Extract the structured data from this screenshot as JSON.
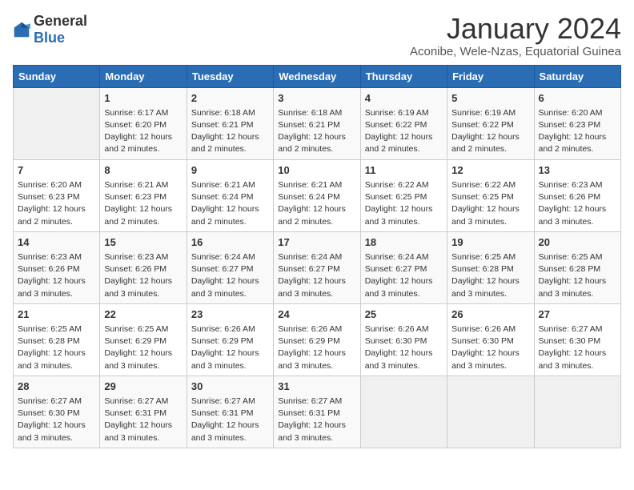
{
  "logo": {
    "general": "General",
    "blue": "Blue"
  },
  "title": "January 2024",
  "subtitle": "Aconibe, Wele-Nzas, Equatorial Guinea",
  "days_of_week": [
    "Sunday",
    "Monday",
    "Tuesday",
    "Wednesday",
    "Thursday",
    "Friday",
    "Saturday"
  ],
  "weeks": [
    [
      {
        "day": "",
        "info": ""
      },
      {
        "day": "1",
        "info": "Sunrise: 6:17 AM\nSunset: 6:20 PM\nDaylight: 12 hours\nand 2 minutes."
      },
      {
        "day": "2",
        "info": "Sunrise: 6:18 AM\nSunset: 6:21 PM\nDaylight: 12 hours\nand 2 minutes."
      },
      {
        "day": "3",
        "info": "Sunrise: 6:18 AM\nSunset: 6:21 PM\nDaylight: 12 hours\nand 2 minutes."
      },
      {
        "day": "4",
        "info": "Sunrise: 6:19 AM\nSunset: 6:22 PM\nDaylight: 12 hours\nand 2 minutes."
      },
      {
        "day": "5",
        "info": "Sunrise: 6:19 AM\nSunset: 6:22 PM\nDaylight: 12 hours\nand 2 minutes."
      },
      {
        "day": "6",
        "info": "Sunrise: 6:20 AM\nSunset: 6:23 PM\nDaylight: 12 hours\nand 2 minutes."
      }
    ],
    [
      {
        "day": "7",
        "info": "Sunrise: 6:20 AM\nSunset: 6:23 PM\nDaylight: 12 hours\nand 2 minutes."
      },
      {
        "day": "8",
        "info": "Sunrise: 6:21 AM\nSunset: 6:23 PM\nDaylight: 12 hours\nand 2 minutes."
      },
      {
        "day": "9",
        "info": "Sunrise: 6:21 AM\nSunset: 6:24 PM\nDaylight: 12 hours\nand 2 minutes."
      },
      {
        "day": "10",
        "info": "Sunrise: 6:21 AM\nSunset: 6:24 PM\nDaylight: 12 hours\nand 2 minutes."
      },
      {
        "day": "11",
        "info": "Sunrise: 6:22 AM\nSunset: 6:25 PM\nDaylight: 12 hours\nand 3 minutes."
      },
      {
        "day": "12",
        "info": "Sunrise: 6:22 AM\nSunset: 6:25 PM\nDaylight: 12 hours\nand 3 minutes."
      },
      {
        "day": "13",
        "info": "Sunrise: 6:23 AM\nSunset: 6:26 PM\nDaylight: 12 hours\nand 3 minutes."
      }
    ],
    [
      {
        "day": "14",
        "info": "Sunrise: 6:23 AM\nSunset: 6:26 PM\nDaylight: 12 hours\nand 3 minutes."
      },
      {
        "day": "15",
        "info": "Sunrise: 6:23 AM\nSunset: 6:26 PM\nDaylight: 12 hours\nand 3 minutes."
      },
      {
        "day": "16",
        "info": "Sunrise: 6:24 AM\nSunset: 6:27 PM\nDaylight: 12 hours\nand 3 minutes."
      },
      {
        "day": "17",
        "info": "Sunrise: 6:24 AM\nSunset: 6:27 PM\nDaylight: 12 hours\nand 3 minutes."
      },
      {
        "day": "18",
        "info": "Sunrise: 6:24 AM\nSunset: 6:27 PM\nDaylight: 12 hours\nand 3 minutes."
      },
      {
        "day": "19",
        "info": "Sunrise: 6:25 AM\nSunset: 6:28 PM\nDaylight: 12 hours\nand 3 minutes."
      },
      {
        "day": "20",
        "info": "Sunrise: 6:25 AM\nSunset: 6:28 PM\nDaylight: 12 hours\nand 3 minutes."
      }
    ],
    [
      {
        "day": "21",
        "info": "Sunrise: 6:25 AM\nSunset: 6:28 PM\nDaylight: 12 hours\nand 3 minutes."
      },
      {
        "day": "22",
        "info": "Sunrise: 6:25 AM\nSunset: 6:29 PM\nDaylight: 12 hours\nand 3 minutes."
      },
      {
        "day": "23",
        "info": "Sunrise: 6:26 AM\nSunset: 6:29 PM\nDaylight: 12 hours\nand 3 minutes."
      },
      {
        "day": "24",
        "info": "Sunrise: 6:26 AM\nSunset: 6:29 PM\nDaylight: 12 hours\nand 3 minutes."
      },
      {
        "day": "25",
        "info": "Sunrise: 6:26 AM\nSunset: 6:30 PM\nDaylight: 12 hours\nand 3 minutes."
      },
      {
        "day": "26",
        "info": "Sunrise: 6:26 AM\nSunset: 6:30 PM\nDaylight: 12 hours\nand 3 minutes."
      },
      {
        "day": "27",
        "info": "Sunrise: 6:27 AM\nSunset: 6:30 PM\nDaylight: 12 hours\nand 3 minutes."
      }
    ],
    [
      {
        "day": "28",
        "info": "Sunrise: 6:27 AM\nSunset: 6:30 PM\nDaylight: 12 hours\nand 3 minutes."
      },
      {
        "day": "29",
        "info": "Sunrise: 6:27 AM\nSunset: 6:31 PM\nDaylight: 12 hours\nand 3 minutes."
      },
      {
        "day": "30",
        "info": "Sunrise: 6:27 AM\nSunset: 6:31 PM\nDaylight: 12 hours\nand 3 minutes."
      },
      {
        "day": "31",
        "info": "Sunrise: 6:27 AM\nSunset: 6:31 PM\nDaylight: 12 hours\nand 3 minutes."
      },
      {
        "day": "",
        "info": ""
      },
      {
        "day": "",
        "info": ""
      },
      {
        "day": "",
        "info": ""
      }
    ]
  ]
}
